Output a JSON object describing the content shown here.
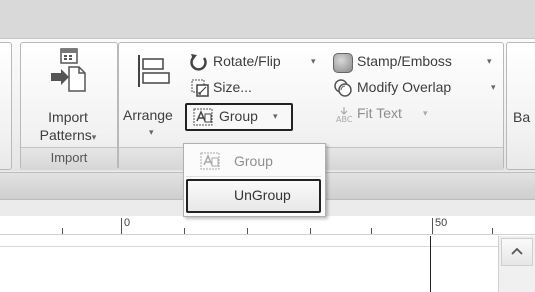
{
  "ribbon": {
    "import_group": {
      "button_label_line1": "Import",
      "button_label_line2": "Patterns",
      "group_label": "Import"
    },
    "arrange_group": {
      "arrange_label": "Arrange",
      "rotate_flip_label": "Rotate/Flip",
      "size_label": "Size...",
      "group_label": "Group",
      "stamp_emboss_label": "Stamp/Emboss",
      "modify_overlap_label": "Modify Overlap",
      "fit_text_label": "Fit Text"
    },
    "truncated_label": "Ba"
  },
  "group_menu": {
    "items": [
      {
        "label": "Group",
        "enabled": false
      },
      {
        "label": "UnGroup",
        "enabled": true
      }
    ]
  },
  "ruler": {
    "labels": [
      "0",
      "50"
    ]
  },
  "colors": {
    "ribbon_bg": "#f2f2f2",
    "highlight_border": "#222222",
    "disabled_text": "#8e8e8e"
  }
}
